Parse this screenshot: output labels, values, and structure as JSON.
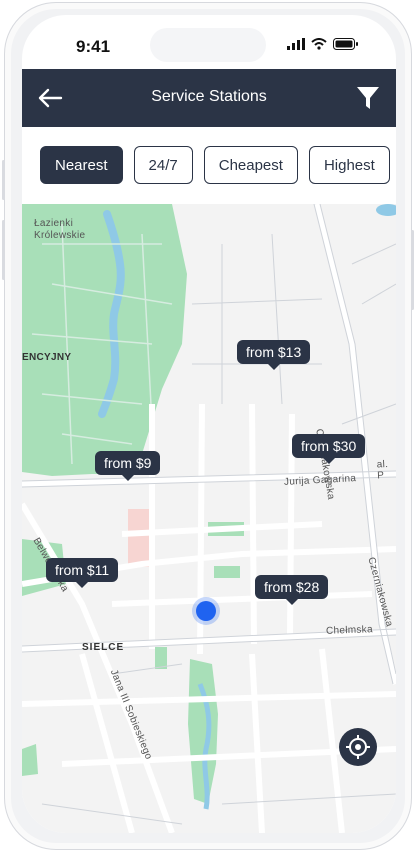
{
  "status_bar": {
    "time": "9:41"
  },
  "header": {
    "title": "Service Stations"
  },
  "filters": [
    "Nearest",
    "24/7",
    "Cheapest",
    "Highest"
  ],
  "map": {
    "labels": {
      "park_line1": "Łazienki",
      "park_line2": "Królewskie",
      "district_top": "ENCYJNY",
      "district_bottom": "SIELCE",
      "street_gagarina": "Jurija Gagarina",
      "street_czerniakowska_top": "Czerniakowska",
      "street_czerniakowska_right": "Czerniakowska",
      "street_belwederska": "Belwederska",
      "street_chelmska": "Chełmska",
      "street_sobieskiego": "Jana III Sobieskiego",
      "street_al": "al. P"
    },
    "pins": [
      {
        "label": "from $13"
      },
      {
        "label": "from $9"
      },
      {
        "label": "from $30"
      },
      {
        "label": "from $11"
      },
      {
        "label": "from $28"
      }
    ]
  },
  "colors": {
    "header": "#2b3446",
    "park": "#a8dfb8",
    "user_location": "#1f63f0"
  }
}
